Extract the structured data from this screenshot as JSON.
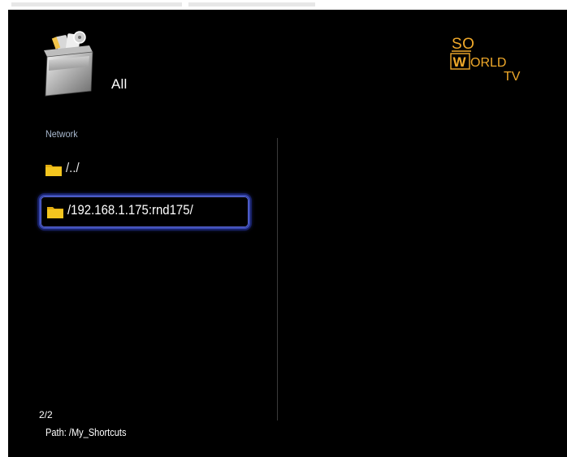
{
  "header": {
    "category_label": "All",
    "category_icon": "media-box-icon",
    "logo": {
      "line1": "SO",
      "line2_prefix": "W",
      "line2_rest": "ORLD",
      "line3": "TV",
      "accent_color": "#f0a92a"
    }
  },
  "browser": {
    "section_label": "Network",
    "items": [
      {
        "label": "/../",
        "icon": "folder-icon",
        "selected": false
      },
      {
        "label": "/192.168.1.175:rnd175/",
        "icon": "folder-icon",
        "selected": true
      }
    ]
  },
  "footer": {
    "counter": "2/2",
    "path": "Path: /My_Shortcuts"
  },
  "colors": {
    "background": "#000000",
    "selection_border": "#3a4ab0",
    "folder": "#f2c21b",
    "section_label": "#a9b9cf"
  }
}
